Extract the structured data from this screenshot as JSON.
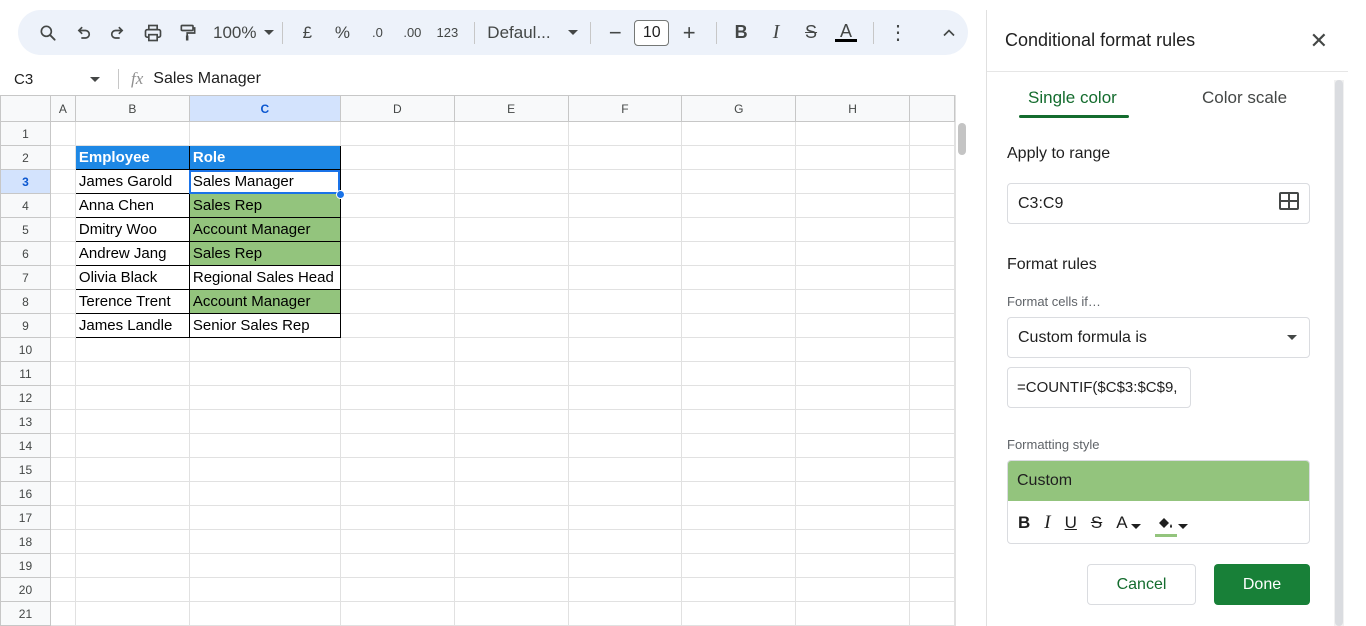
{
  "toolbar": {
    "zoom": "100%",
    "currency": "£",
    "percent": "%",
    "dec_decrease": ".0",
    "dec_increase": ".00",
    "number_format": "123",
    "font": "Defaul...",
    "font_size": "10",
    "bold": "B",
    "italic": "I",
    "strike": "S",
    "text_color": "A",
    "more": "⋮",
    "collapse": "^"
  },
  "formula_bar": {
    "name_box": "C3",
    "fx": "fx",
    "formula": "Sales Manager"
  },
  "sheet": {
    "columns": [
      "A",
      "B",
      "C",
      "D",
      "E",
      "F",
      "G",
      "H"
    ],
    "rows": [
      "1",
      "2",
      "3",
      "4",
      "5",
      "6",
      "7",
      "8",
      "9",
      "10",
      "11",
      "12",
      "13",
      "14",
      "15",
      "16",
      "17",
      "18",
      "19",
      "20",
      "21"
    ],
    "selected_column": "C",
    "selected_row": "3",
    "header": {
      "b": "Employee",
      "c": "Role"
    },
    "data": [
      {
        "b": "James Garold",
        "c": "Sales Manager",
        "highlight": false
      },
      {
        "b": "Anna Chen",
        "c": "Sales Rep",
        "highlight": true
      },
      {
        "b": "Dmitry Woo",
        "c": "Account Manager",
        "highlight": true
      },
      {
        "b": "Andrew Jang",
        "c": "Sales Rep",
        "highlight": true
      },
      {
        "b": "Olivia Black",
        "c": "Regional Sales Head",
        "highlight": false
      },
      {
        "b": "Terence Trent",
        "c": "Account Manager",
        "highlight": true
      },
      {
        "b": "James Landle",
        "c": "Senior Sales Rep",
        "highlight": false
      }
    ],
    "header_color": "#1e88e5",
    "highlight_color": "#93c47d"
  },
  "panel": {
    "title": "Conditional format rules",
    "close": "✕",
    "tabs": {
      "single": "Single color",
      "scale": "Color scale"
    },
    "apply_to_range_label": "Apply to range",
    "range": "C3:C9",
    "format_rules_label": "Format rules",
    "format_cells_if_label": "Format cells if…",
    "condition": "Custom formula is",
    "formula_value": "=COUNTIF($C$3:$C$9,",
    "formatting_style_label": "Formatting style",
    "style_preview": "Custom",
    "style_tools": {
      "bold": "B",
      "italic": "I",
      "underline": "U",
      "strike": "S",
      "text_color": "A"
    },
    "cancel": "Cancel",
    "done": "Done",
    "accent_color": "#146c2e"
  }
}
